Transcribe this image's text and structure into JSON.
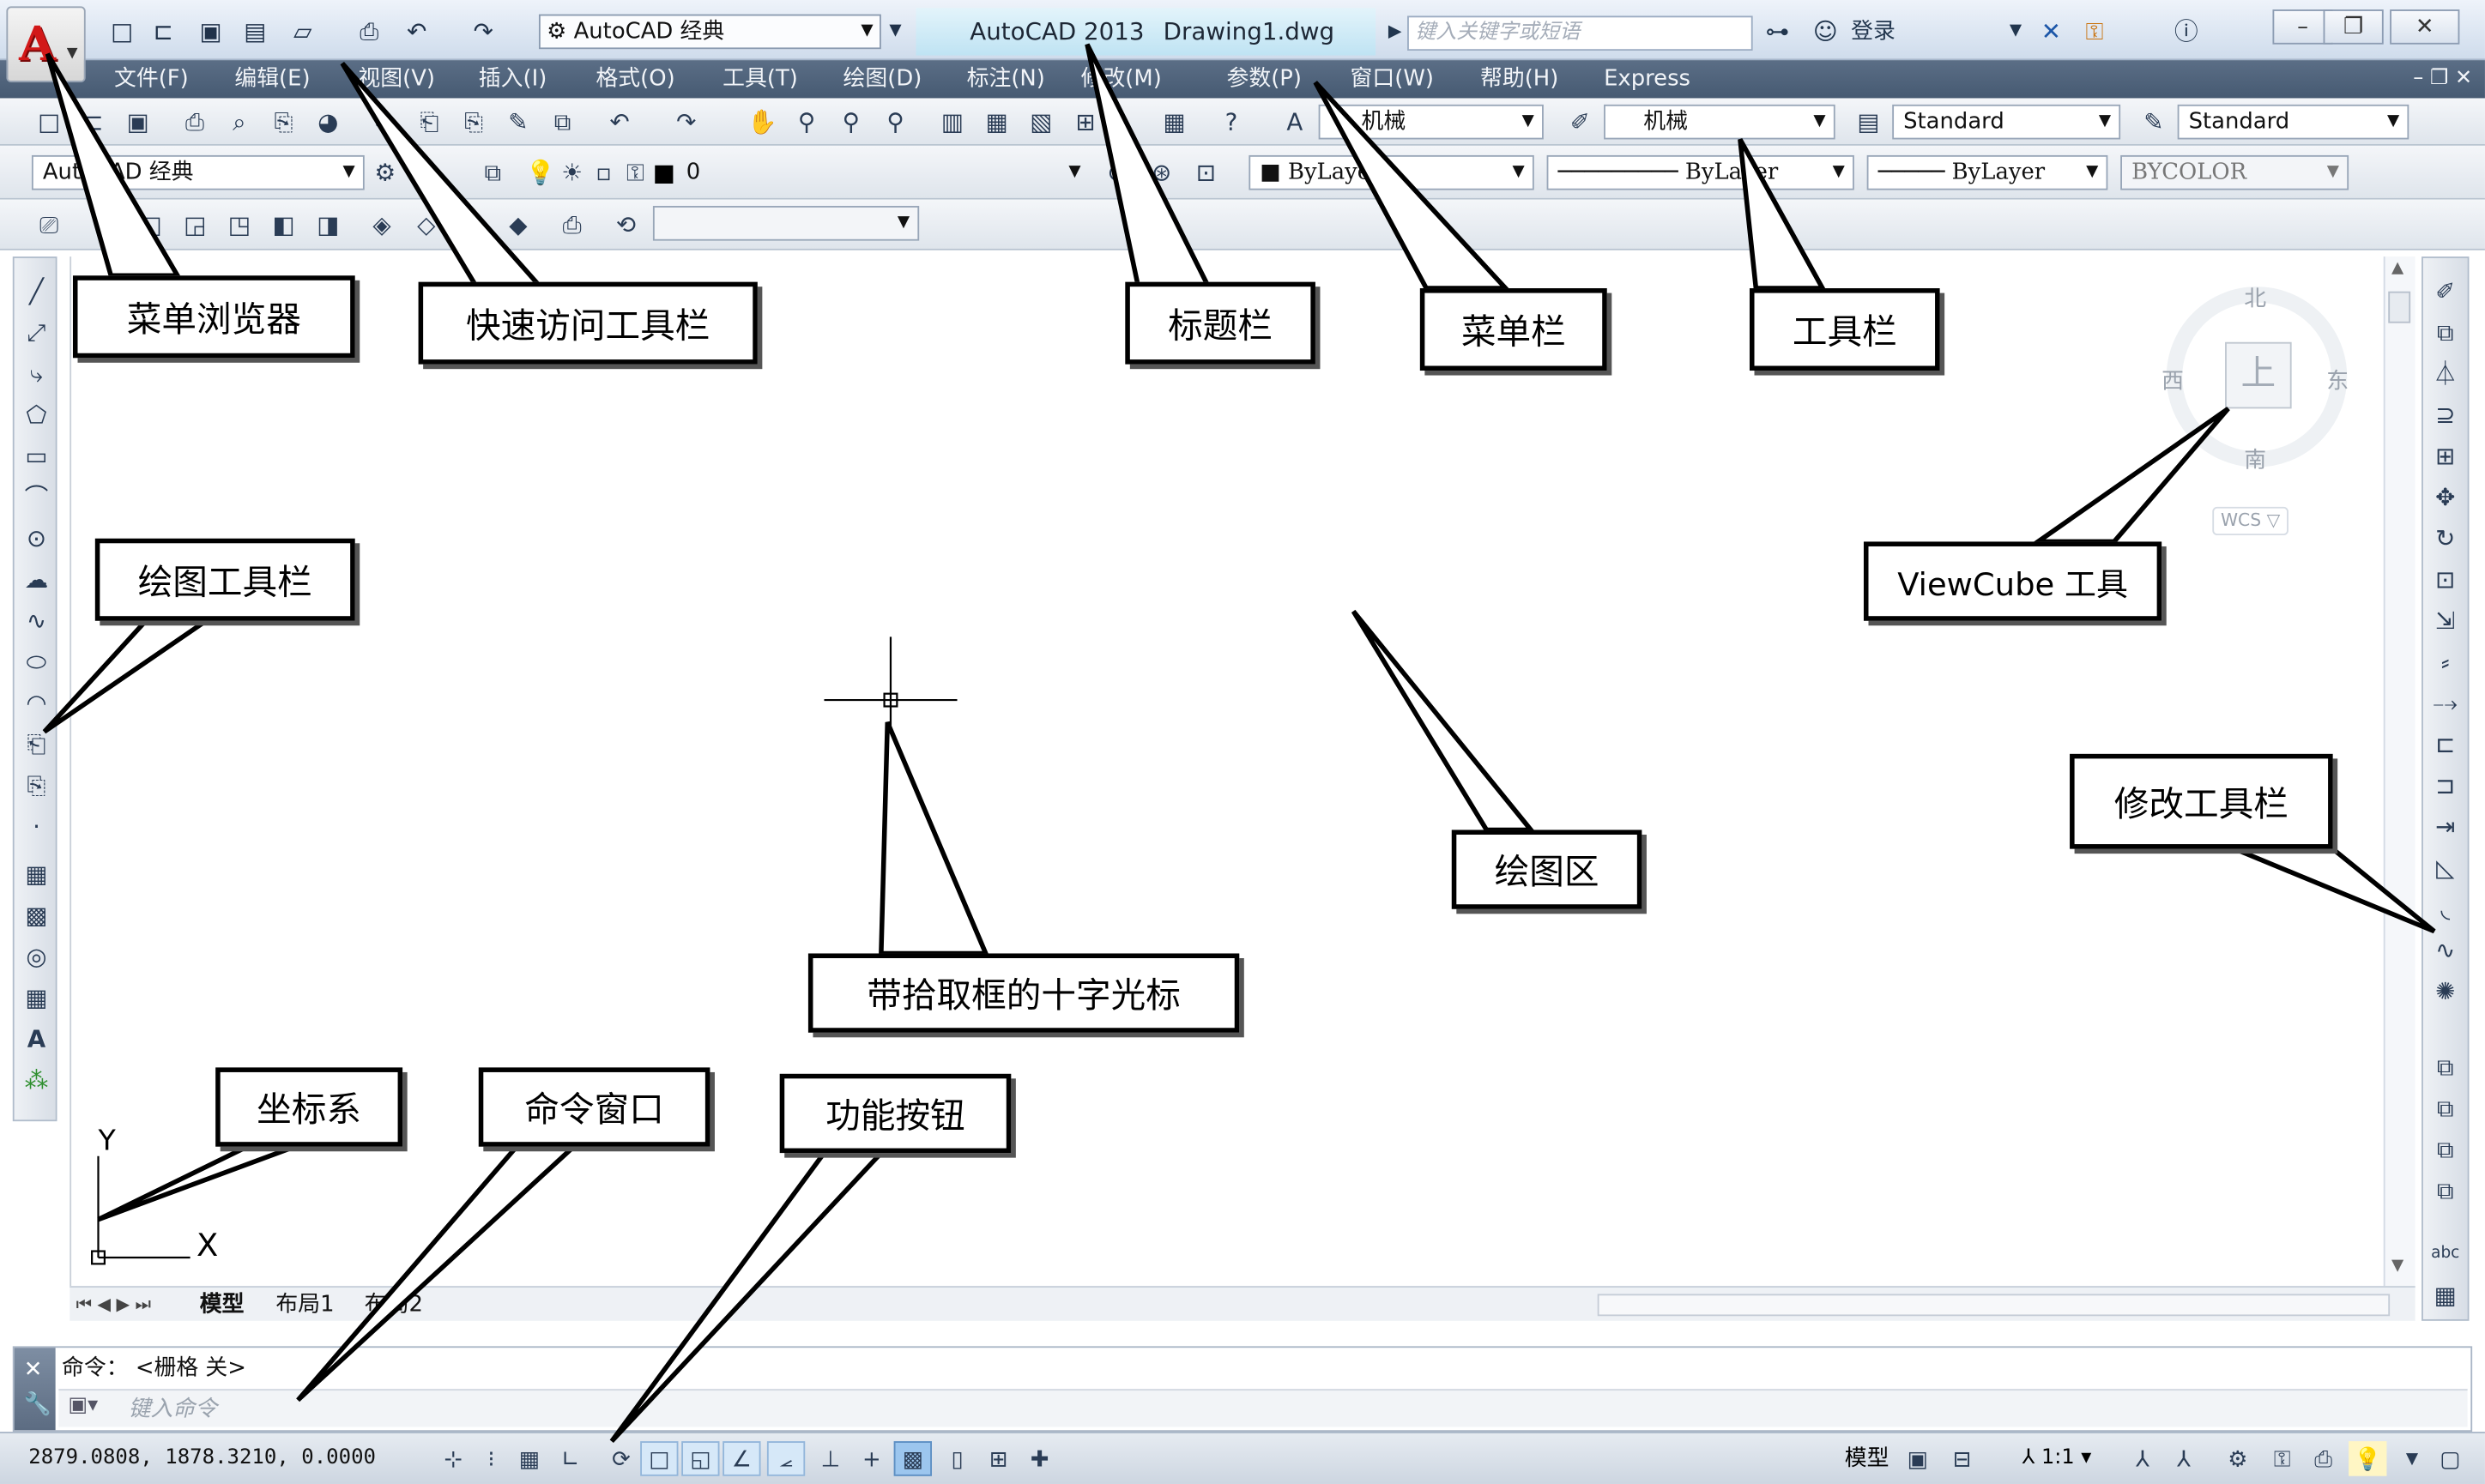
{
  "title_bar": {
    "app_logo": "A",
    "workspace": "AutoCAD 经典",
    "app_name": "AutoCAD 2013",
    "document": "Drawing1.dwg",
    "search_placeholder": "键入关键字或短语",
    "sign_in": "登录"
  },
  "menu": {
    "items": [
      "文件(F)",
      "编辑(E)",
      "视图(V)",
      "插入(I)",
      "格式(O)",
      "工具(T)",
      "绘图(D)",
      "标注(N)",
      "修改(M)",
      "参数(P)",
      "窗口(W)",
      "帮助(H)",
      "Express"
    ]
  },
  "toolbars": {
    "text_style": "机械",
    "dim_style": "机械",
    "table_style": "Standard",
    "multileader_style": "Standard",
    "workspace_combo": "AutoCAD 经典",
    "layer_name": "0",
    "color": "ByLayer",
    "linetype": "ByLayer",
    "lineweight": "ByLayer",
    "plot_style": "BYCOLOR"
  },
  "viewcube": {
    "north": "北",
    "south": "南",
    "east": "东",
    "west": "西",
    "face": "上",
    "ucs": "WCS"
  },
  "ucs_icon": {
    "x_label": "X",
    "y_label": "Y"
  },
  "layout_tabs": [
    "模型",
    "布局1",
    "布局2"
  ],
  "command": {
    "history": "命令：  <栅格 关>",
    "placeholder": "键入命令"
  },
  "status": {
    "coords": "2879.0808,  1878.3210,  0.0000",
    "model_label": "模型",
    "annotation_scale": "1:1"
  },
  "callouts": {
    "menu_browser": "菜单浏览器",
    "quick_access": "快速访问工具栏",
    "title_bar": "标题栏",
    "menu_bar": "菜单栏",
    "toolbar": "工具栏",
    "draw_toolbar": "绘图工具栏",
    "viewcube": "ViewCube 工具",
    "drawing_area": "绘图区",
    "modify_toolbar": "修改工具栏",
    "crosshair": "带拾取框的十字光标",
    "ucs": "坐标系",
    "command_window": "命令窗口",
    "function_buttons": "功能按钮"
  }
}
